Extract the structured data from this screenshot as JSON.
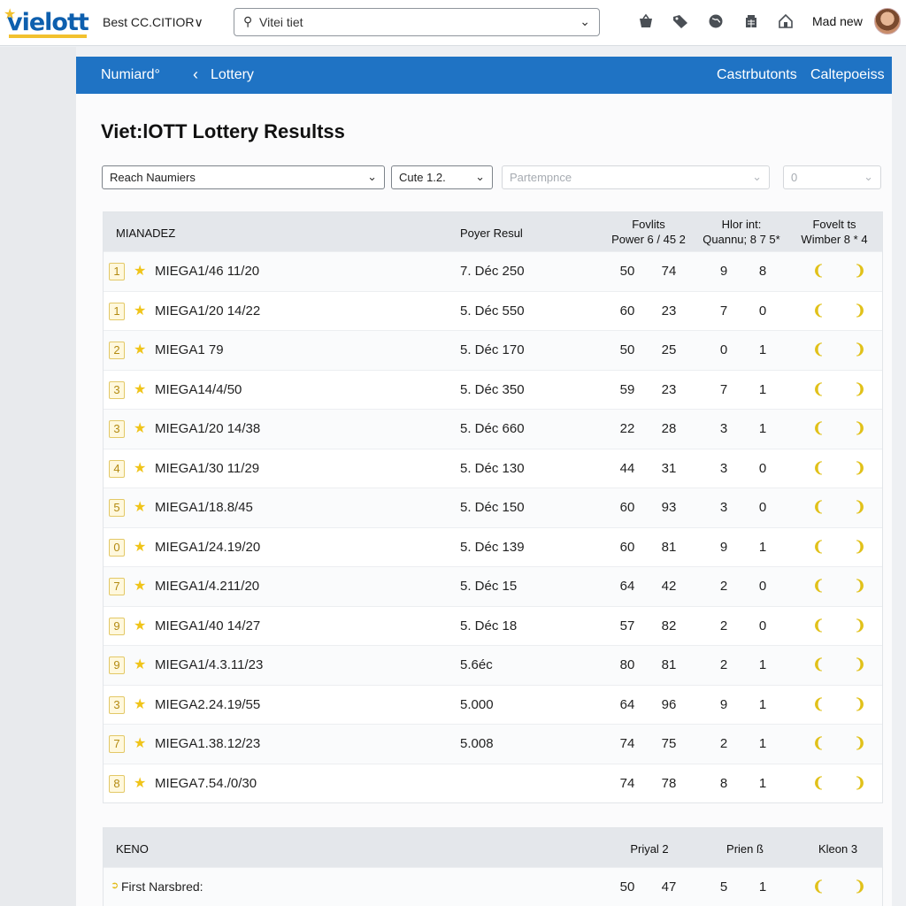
{
  "topbar": {
    "logo_text": "vielott",
    "site_select": "Best CC.CITIOR∨",
    "search_value": "Vitei tiet",
    "icons": [
      "basket-icon",
      "tag-icon",
      "globe-icon",
      "grid-icon",
      "home-icon"
    ],
    "user_name": "Mad new"
  },
  "nav": {
    "home": "Numiard°",
    "current": "Lottery",
    "right_links": [
      "Castrbutonts",
      "Caltepoeiss"
    ]
  },
  "page": {
    "title": "Viet:lOTT Lottery Resultss"
  },
  "filters": [
    {
      "label": "Reach Naumiers",
      "disabled": false
    },
    {
      "label": "Cute 1.2.",
      "disabled": false
    },
    {
      "label": "Partempnce",
      "disabled": true
    },
    {
      "label": "0",
      "disabled": true
    }
  ],
  "mega_table": {
    "headers": {
      "game": "MIANADEZ",
      "result": "Poyer Resul",
      "col_a": "Fovlits\nPower 6 / 45 2",
      "col_b": "Hlor int:\nQuannu; 8 7 5*",
      "col_c": "Fovelt ts\nWimber 8 * 4"
    },
    "rows": [
      {
        "rank": "1",
        "game": "MIEGA1/46 11/20",
        "date": "7. Déc 250",
        "n1": "50",
        "n2": "74",
        "n3": "9",
        "n4": "8"
      },
      {
        "rank": "1",
        "game": "MIEGA1/20 14/22",
        "date": "5. Déc 550",
        "n1": "60",
        "n2": "23",
        "n3": "7",
        "n4": "0"
      },
      {
        "rank": "2",
        "game": "MIEGA1 79",
        "date": "5. Déc 170",
        "n1": "50",
        "n2": "25",
        "n3": "0",
        "n4": "1"
      },
      {
        "rank": "3",
        "game": "MIEGA14/4/50",
        "date": "5. Déc 350",
        "n1": "59",
        "n2": "23",
        "n3": "7",
        "n4": "1"
      },
      {
        "rank": "3",
        "game": "MIEGA1/20 14/38",
        "date": "5. Déc 660",
        "n1": "22",
        "n2": "28",
        "n3": "3",
        "n4": "1"
      },
      {
        "rank": "4",
        "game": "MIEGA1/30 11/29",
        "date": "5. Déc 130",
        "n1": "44",
        "n2": "31",
        "n3": "3",
        "n4": "0"
      },
      {
        "rank": "5",
        "game": "MIEGA1/18.8/45",
        "date": "5. Déc 150",
        "n1": "60",
        "n2": "93",
        "n3": "3",
        "n4": "0"
      },
      {
        "rank": "0",
        "game": "MIEGA1/24.19/20",
        "date": "5. Déc 139",
        "n1": "60",
        "n2": "81",
        "n3": "9",
        "n4": "1"
      },
      {
        "rank": "7",
        "game": "MIEGA1/4.211/20",
        "date": "5. Déc 15",
        "n1": "64",
        "n2": "42",
        "n3": "2",
        "n4": "0"
      },
      {
        "rank": "9",
        "game": "MIEGA1/40 14/27",
        "date": "5. Déc 18",
        "n1": "57",
        "n2": "82",
        "n3": "2",
        "n4": "0"
      },
      {
        "rank": "9",
        "game": "MIEGA1/4.3.11/23",
        "date": "5.6éc",
        "n1": "80",
        "n2": "81",
        "n3": "2",
        "n4": "1"
      },
      {
        "rank": "3",
        "game": "MIEGA2.24.19/55",
        "date": "5.000",
        "n1": "64",
        "n2": "96",
        "n3": "9",
        "n4": "1"
      },
      {
        "rank": "7",
        "game": "MIEGA1.38.12/23",
        "date": "5.008",
        "n1": "74",
        "n2": "75",
        "n3": "2",
        "n4": "1"
      },
      {
        "rank": "8",
        "game": "MIEGA7.54./0/30",
        "date": "",
        "n1": "74",
        "n2": "78",
        "n3": "8",
        "n4": "1"
      }
    ]
  },
  "keno_table": {
    "headers": {
      "game": "KENO",
      "col_a": "Priyal 2",
      "col_b": "Prien ß",
      "col_c": "Kleon 3"
    },
    "rows": [
      {
        "game": "First Narsbred:",
        "n1": "50",
        "n2": "47",
        "n3": "5",
        "n4": "1"
      }
    ]
  },
  "colors": {
    "nav_blue": "#1f73c4",
    "accent_yellow": "#f0c419",
    "logo_blue": "#0d5fae"
  }
}
